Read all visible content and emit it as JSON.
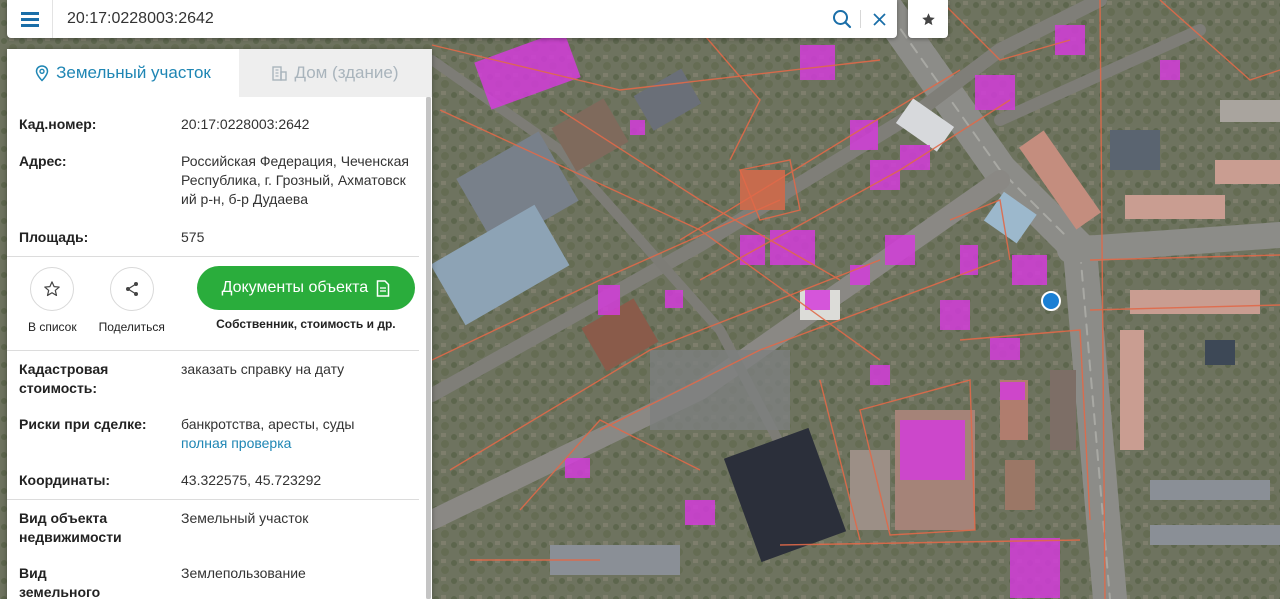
{
  "search": {
    "value": "20:17:0228003:2642"
  },
  "panel": {
    "tabs": [
      {
        "label": "Земельный участок",
        "icon": "location-pin-icon",
        "active": true
      },
      {
        "label": "Дом (здание)",
        "icon": "building-icon",
        "active": false
      }
    ],
    "cadastral_number": {
      "label": "Кад.номер:",
      "value": "20:17:0228003:2642"
    },
    "address": {
      "label": "Адрес:",
      "value": "Российская Федерация, Чеченская Республика, г. Грозный, Ахматовский р-н, б-р Дудаева"
    },
    "area": {
      "label": "Площадь:",
      "value": "575"
    },
    "actions": {
      "favorite_label": "В список",
      "share_label": "Поделиться",
      "documents_label": "Документы объекта",
      "documents_sub": "Собственник, стоимость и др."
    },
    "cadastral_value": {
      "label": "Кадастровая стоимость:",
      "link": "заказать справку на дату"
    },
    "risks": {
      "label": "Риски при сделке:",
      "value": "банкротства, аресты, суды",
      "link": "полная проверка"
    },
    "coordinates": {
      "label": "Координаты:",
      "value": "43.322575, 45.723292"
    },
    "object_type": {
      "label": "Вид объекта недвижимости",
      "value": "Земельный участок"
    },
    "land_type": {
      "label": "Вид земельного участка",
      "value": "Землепользование"
    }
  },
  "colors": {
    "accent": "#1f86b4",
    "documents_button": "#2aad3c",
    "menu_icon": "#1a6ea8",
    "parcel_highlight": "#d43ddb",
    "parcel_border": "#e06a4a",
    "selected_marker": "#1a7fd4"
  }
}
